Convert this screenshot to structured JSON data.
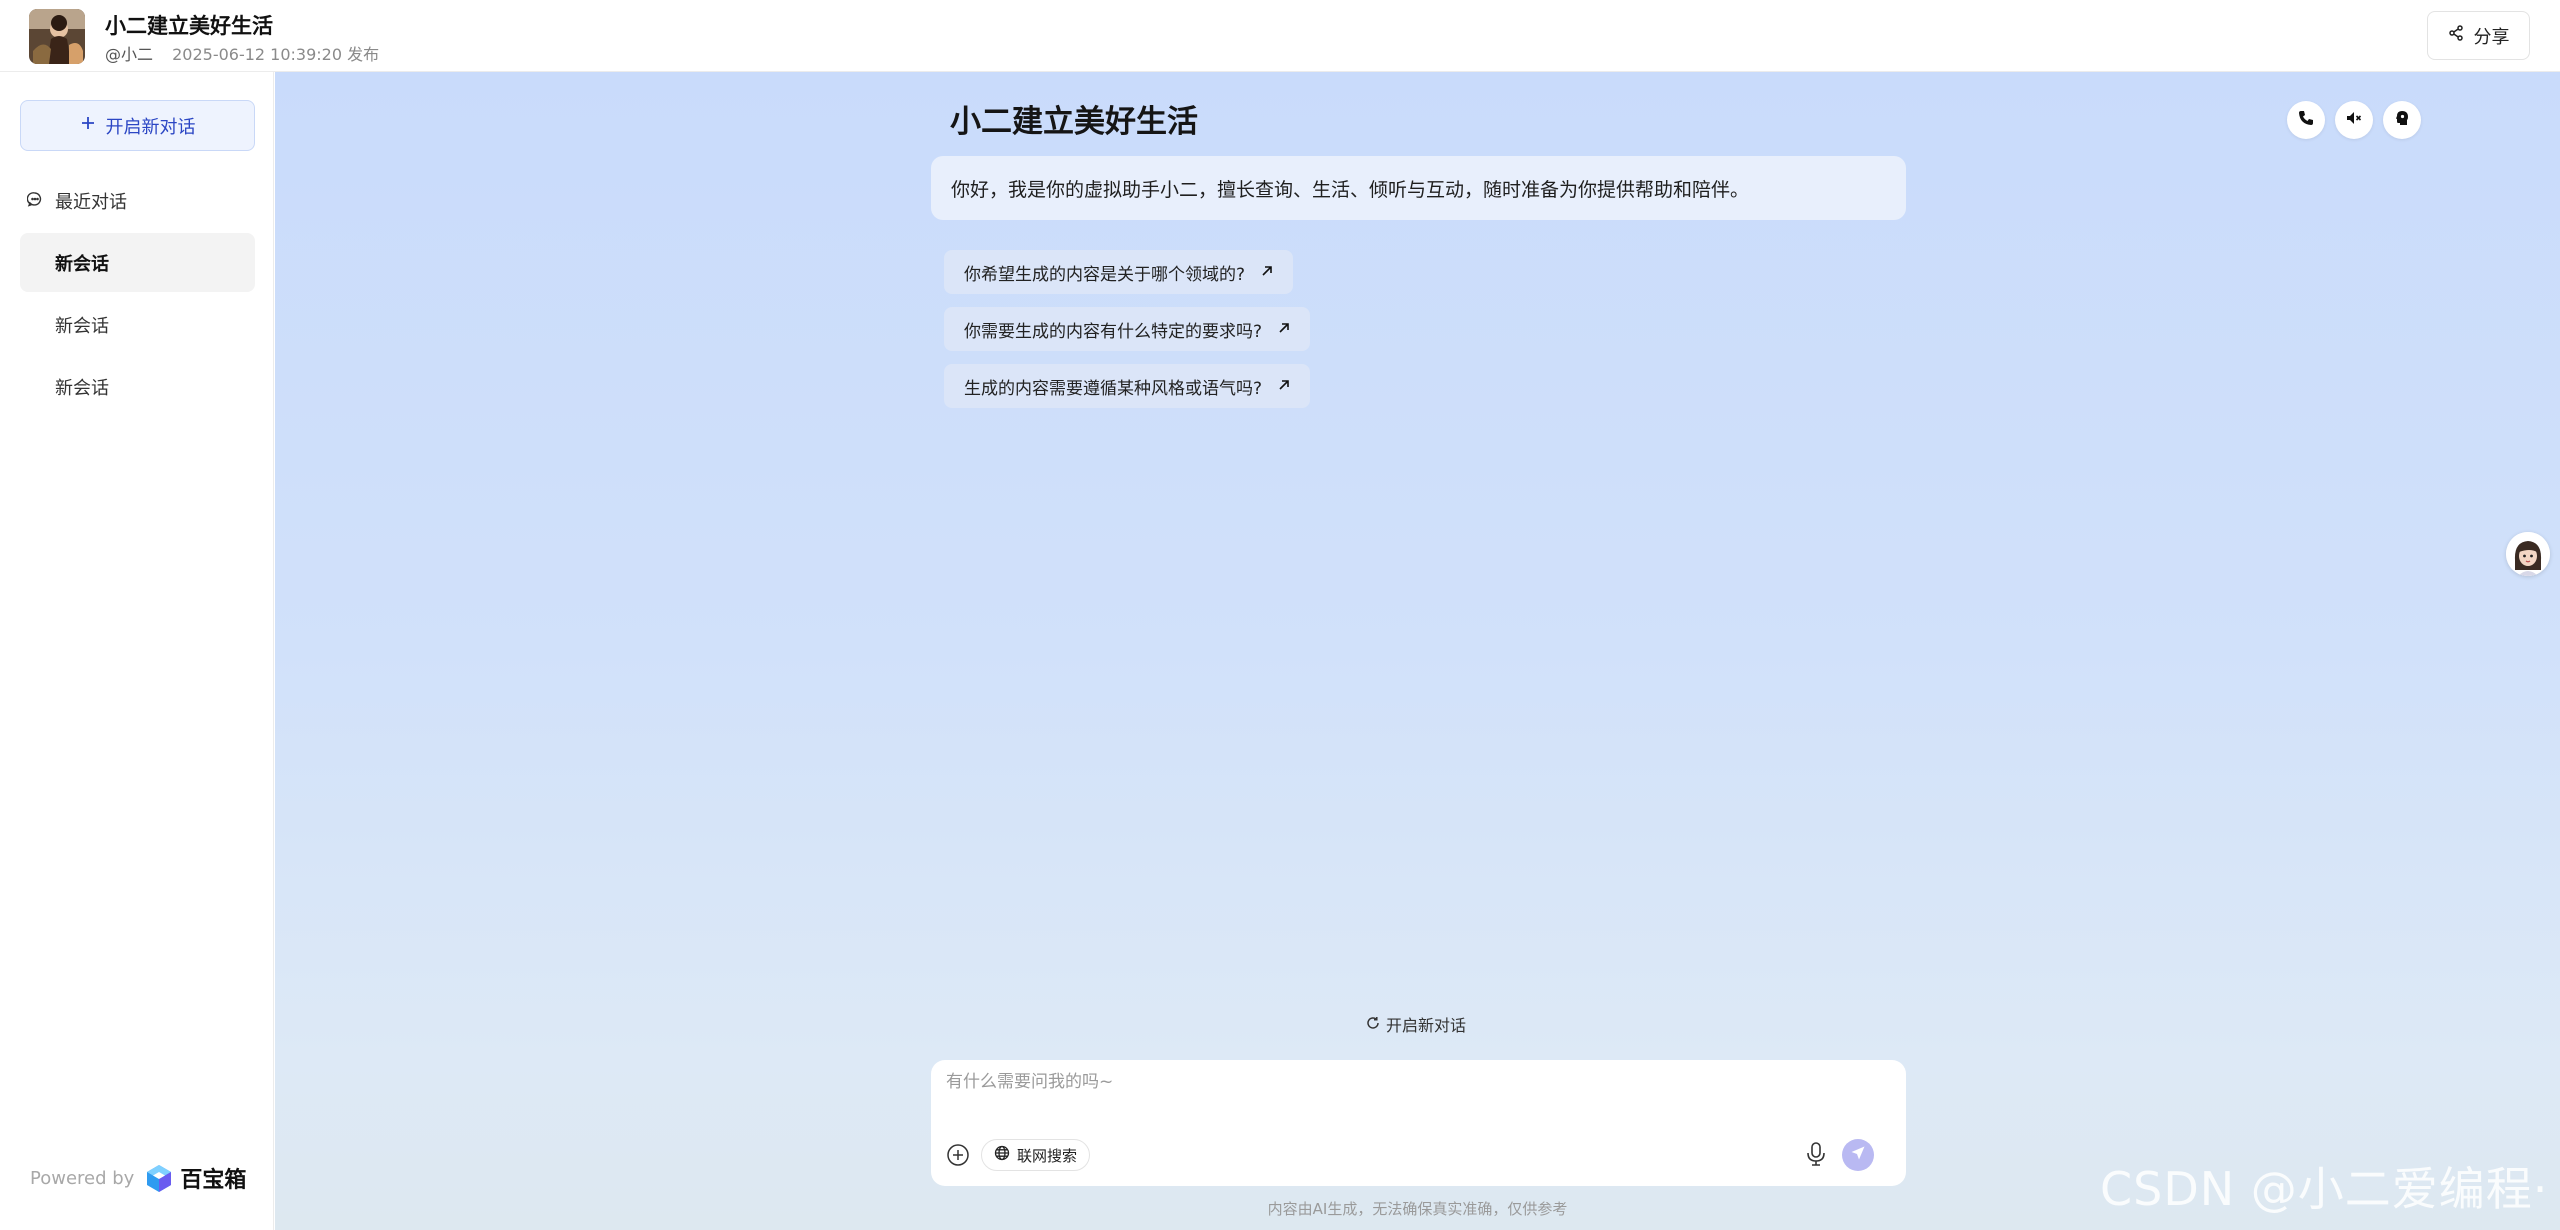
{
  "header": {
    "title": "小二建立美好生活",
    "author": "@小二",
    "published": "2025-06-12 10:39:20 发布",
    "share_label": "分享"
  },
  "sidebar": {
    "new_chat_label": "开启新对话",
    "recent_label": "最近对话",
    "sessions": [
      {
        "label": "新会话",
        "active": true
      },
      {
        "label": "新会话",
        "active": false
      },
      {
        "label": "新会话",
        "active": false
      }
    ],
    "powered_by": "Powered by",
    "brand": "百宝箱"
  },
  "main": {
    "title": "小二建立美好生活",
    "greeting": "你好，我是你的虚拟助手小二，擅长查询、生活、倾听与互动，随时准备为你提供帮助和陪伴。",
    "suggestions": [
      "你希望生成的内容是关于哪个领域的?",
      "你需要生成的内容有什么特定的要求吗?",
      "生成的内容需要遵循某种风格或语气吗?"
    ],
    "top_icons": [
      "phone-icon",
      "mute-icon",
      "head-icon"
    ],
    "new_chat_label": "开启新对话",
    "input_placeholder": "有什么需要问我的吗~",
    "web_search_label": "联网搜索",
    "disclaimer": "内容由AI生成，无法确保真实准确，仅供参考",
    "watermark": "CSDN @小二爱编程·"
  },
  "colors": {
    "accent": "#2b46c4",
    "send": "#b9b9f2",
    "main_bg_top": "#c9dbfb",
    "main_bg_bottom": "#dde8f0"
  }
}
